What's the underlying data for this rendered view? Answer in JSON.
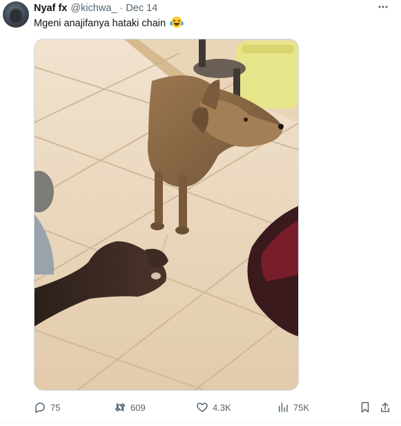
{
  "tweet": {
    "author_name": "Nyaf fx",
    "handle": "@kichwa_",
    "separator": "·",
    "date": "Dec 14",
    "text": "Mgeni anajifanya hataki chain",
    "emoji_icon": "face-with-tears-of-joy-icon",
    "media_icon": "photo-dog-on-tiled-floor"
  },
  "actions": {
    "reply_count": "75",
    "retweet_count": "609",
    "like_count": "4.3K",
    "views_count": "75K"
  },
  "colors": {
    "text_primary": "#0f1419",
    "text_secondary": "#536471",
    "border": "#cfd9de",
    "floor_tile": "#e7d3b8",
    "dog_fur": "#8c6a45",
    "jerrycan": "#e7e58a"
  }
}
